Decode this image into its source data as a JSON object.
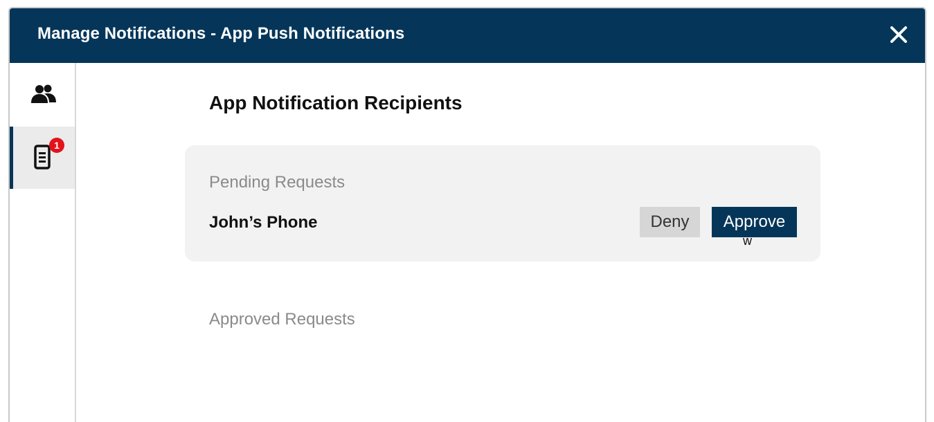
{
  "modal": {
    "title": "Manage Notifications - App Push Notifications",
    "close_icon": "close-icon"
  },
  "sidebar": {
    "items": [
      {
        "name": "recipients",
        "icon": "users-icon",
        "selected": false
      },
      {
        "name": "app-notifications",
        "icon": "mobile-phone-icon",
        "selected": true,
        "badge": "1"
      }
    ]
  },
  "main": {
    "heading": "App Notification Recipients",
    "pending": {
      "label": "Pending Requests",
      "requests": [
        {
          "device": "John’s Phone",
          "deny_label": "Deny",
          "approve_label": "Approve"
        }
      ],
      "stray_text": "w"
    },
    "approved": {
      "label": "Approved Requests"
    }
  },
  "colors": {
    "header": "#053659",
    "accent": "#053659",
    "badge": "#e3121b",
    "card_bg": "#f2f2f2",
    "deny_bg": "#d6d6d6"
  }
}
